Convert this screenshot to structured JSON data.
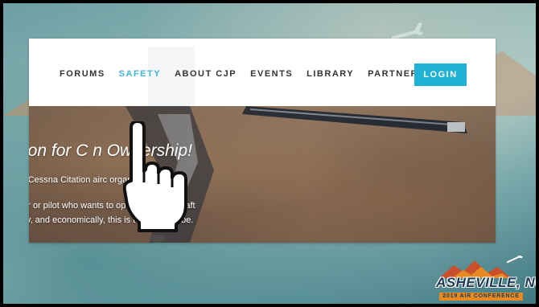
{
  "nav": {
    "items": [
      {
        "label": "FORUMS"
      },
      {
        "label": "SAFETY"
      },
      {
        "label": "ABOUT CJP"
      },
      {
        "label": "EVENTS"
      },
      {
        "label": "LIBRARY"
      },
      {
        "label": "PARTNERS"
      }
    ],
    "active_item": "SAFETY",
    "login_label": "LOGIN"
  },
  "hero": {
    "title": "ion for C                      n Ownership!",
    "line1": "r Cessna Citation airc                          organization.",
    "line2": "er or pilot who wants to operate your aircraft",
    "line3": "lly, and economically, this is the place to be."
  },
  "conference": {
    "name": "ASHEVILLE, NC",
    "subtitle": "2019 AIR CONFERENCE"
  },
  "colors": {
    "accent": "#1fb2d6",
    "active_nav": "#3bb8d8",
    "logo_orange": "#e58a25",
    "logo_navy": "#1c3a52"
  },
  "icons": [
    "pointing-hand-cursor-icon",
    "airplane-icon",
    "mountain-icon"
  ]
}
